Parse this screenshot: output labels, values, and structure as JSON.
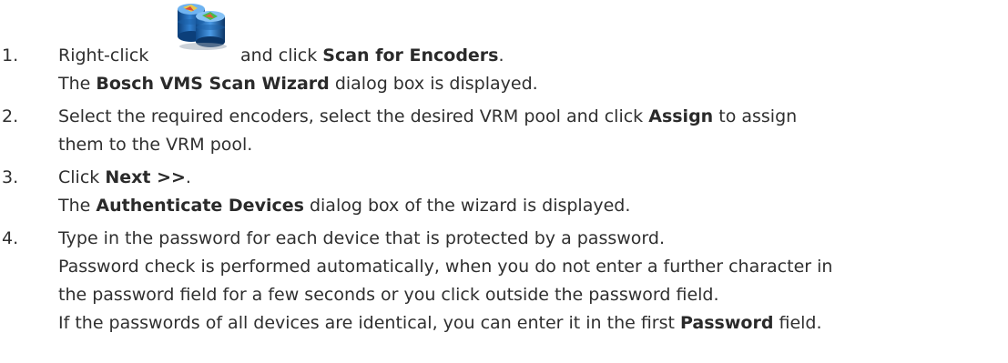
{
  "steps": [
    {
      "number": "1.",
      "lines": [
        {
          "parts": [
            "Right-click",
            "and click ",
            "Scan for Encoders",
            "."
          ]
        },
        {
          "parts": [
            "The ",
            "Bosch VMS Scan Wizard",
            " dialog box is displayed."
          ]
        }
      ]
    },
    {
      "number": "2.",
      "lines": [
        {
          "parts": [
            "Select the required encoders, select the desired VRM pool and click ",
            "Assign",
            " to assign"
          ]
        },
        {
          "parts": [
            "them to the VRM pool."
          ]
        }
      ]
    },
    {
      "number": "3.",
      "lines": [
        {
          "parts": [
            "Click ",
            "Next >>",
            "."
          ]
        },
        {
          "parts": [
            "The ",
            "Authenticate Devices",
            " dialog box of the wizard is displayed."
          ]
        }
      ]
    },
    {
      "number": "4.",
      "lines": [
        {
          "parts": [
            "Type in the password for each device that is protected by a password."
          ]
        },
        {
          "parts": [
            "Password check is performed automatically, when you do not enter a further character in"
          ]
        },
        {
          "parts": [
            "the password field for a few seconds or you click outside the password field."
          ]
        },
        {
          "parts": [
            "If the passwords of all devices are identical, you can enter it in the first ",
            "Password",
            " field."
          ]
        }
      ]
    }
  ],
  "icon": {
    "name": "vrm-pool-database-icon"
  }
}
